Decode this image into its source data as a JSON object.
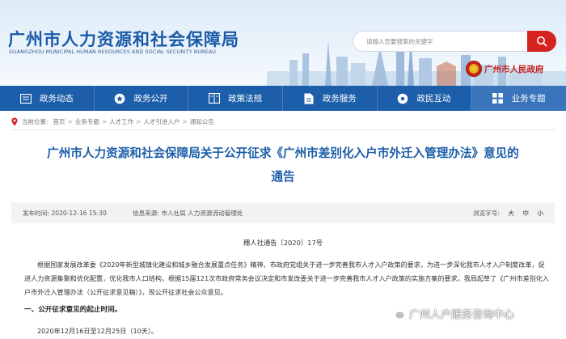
{
  "header": {
    "title": "广州市人力资源和社会保障局",
    "subtitle": "GUANGZHOU MUNICIPAL HUMAN RESOURCES AND SOCIAL SECURITY BUREAU",
    "search_placeholder": "请输入您要搜索的关键字",
    "search_icon": "search-icon",
    "gov_link": "广州市人民政府",
    "colors": {
      "brand_blue": "#1c5ea9",
      "search_red": "#d7231f",
      "gov_red": "#c8221c"
    }
  },
  "nav": {
    "items": [
      {
        "label": "政务动态",
        "icon": "news-icon"
      },
      {
        "label": "政务公开",
        "icon": "star-badge-icon"
      },
      {
        "label": "政策法规",
        "icon": "law-book-icon"
      },
      {
        "label": "政务服务",
        "icon": "document-icon"
      },
      {
        "label": "政民互动",
        "icon": "interaction-icon"
      },
      {
        "label": "业务专题",
        "icon": "grid-icon"
      }
    ]
  },
  "breadcrumb": {
    "prefix": "当前位置:",
    "items": [
      "首页",
      "业务专题",
      "人才工作",
      "人才引进入户",
      "通知公告"
    ],
    "separator": ">"
  },
  "article": {
    "title_line1": "广州市人力资源和社会保障局关于公开征求《广州市差别化入户市外迁入管理办法》意见的",
    "title_line2": "通告",
    "publish_date": "发布时间:   2020-12-16 15:30",
    "source": "信息来源:   市人社局 人力资源流动管理处",
    "font_size_label": "浏览字号:",
    "font_sizes": [
      "大",
      "中",
      "小"
    ],
    "doc_number": "穗人社通告〔2020〕17号",
    "paragraph": "根据国家发展改革委《2020年新型城镇化建设和城乡融合发展重点任务》精神、市政府党组关于进一步完善我市人才入户政策的要求，为进一步深化我市人才入户制度改革，促进人力资源集聚和优化配置，优化我市人口结构，根据15届121次市政府常务会议决定和市发改委关于进一步完善我市人才入户政策的实施方案的要求，我局起草了《广州市差别化入户市外迁入管理办法（公开征求意见稿）》，现公开征求社会公众意见。",
    "section1_heading": "一、公开征求意见的起止时间。",
    "section1_period": "2020年12月16日至12月25日（10天）。"
  },
  "watermark": {
    "text": "广州人户服务咨询中心",
    "icon": "wechat-icon"
  }
}
